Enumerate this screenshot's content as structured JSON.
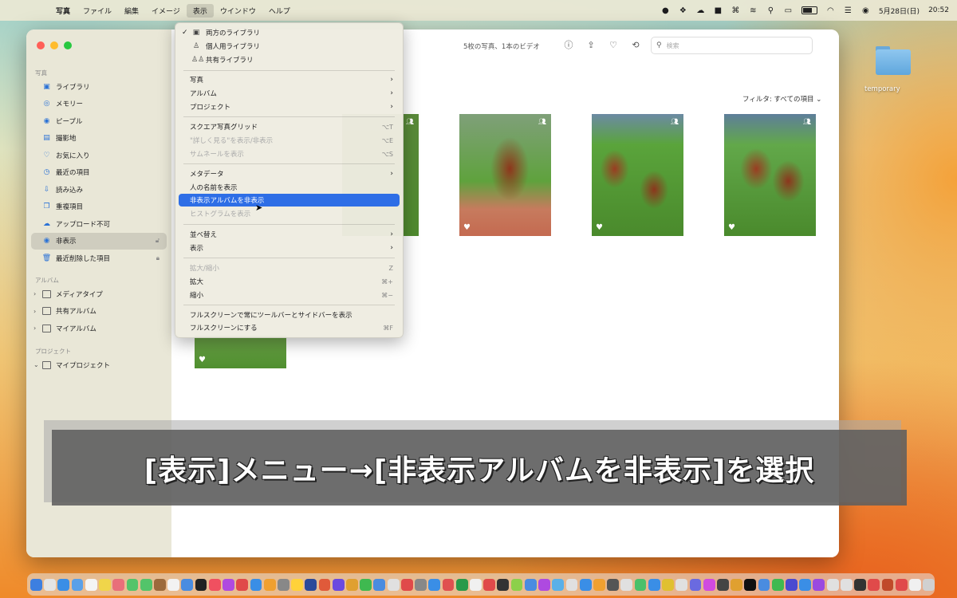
{
  "menubar": {
    "app": "写真",
    "menus": [
      "ファイル",
      "編集",
      "イメージ",
      "表示",
      "ウインドウ",
      "ヘルプ"
    ],
    "date": "5月28日(日)",
    "time": "20:52"
  },
  "sidebar": {
    "section_photos": "写真",
    "items": [
      {
        "label": "ライブラリ",
        "icon": "photo-library-icon"
      },
      {
        "label": "メモリー",
        "icon": "memories-icon"
      },
      {
        "label": "ピープル",
        "icon": "people-icon"
      },
      {
        "label": "撮影地",
        "icon": "places-icon"
      },
      {
        "label": "お気に入り",
        "icon": "heart-icon"
      },
      {
        "label": "最近の項目",
        "icon": "clock-icon"
      },
      {
        "label": "読み込み",
        "icon": "import-icon"
      },
      {
        "label": "重複項目",
        "icon": "duplicates-icon"
      },
      {
        "label": "アップロード不可",
        "icon": "cloud-alert-icon"
      },
      {
        "label": "非表示",
        "icon": "eye-icon"
      },
      {
        "label": "最近削除した項目",
        "icon": "trash-icon"
      }
    ],
    "section_albums": "アルバム",
    "albums": [
      {
        "label": "メディアタイプ"
      },
      {
        "label": "共有アルバム"
      },
      {
        "label": "マイアルバム"
      }
    ],
    "section_projects": "プロジェクト",
    "projects": [
      {
        "label": "マイプロジェクト"
      }
    ]
  },
  "toolbar": {
    "count": "5枚の写真、1本のビデオ",
    "search_placeholder": "検索"
  },
  "filter": {
    "label": "フィルタ: ",
    "value": "すべての項目"
  },
  "view_menu": {
    "items": [
      {
        "label": "両方のライブラリ",
        "checked": true
      },
      {
        "label": "個人用ライブラリ"
      },
      {
        "label": "共有ライブラリ"
      },
      {
        "label": "写真"
      },
      {
        "label": "アルバム"
      },
      {
        "label": "プロジェクト"
      },
      {
        "label": "スクエア写真グリッド",
        "shortcut": "⌥T"
      },
      {
        "label": "\"詳しく見る\"を表示/非表示",
        "shortcut": "⌥E"
      },
      {
        "label": "サムネールを表示",
        "shortcut": "⌥S"
      },
      {
        "label": "メタデータ"
      },
      {
        "label": "人の名前を表示"
      },
      {
        "label": "非表示アルバムを非表示"
      },
      {
        "label": "ヒストグラムを表示"
      },
      {
        "label": "並べ替え"
      },
      {
        "label": "表示"
      },
      {
        "label": "拡大/縮小",
        "shortcut": "Z"
      },
      {
        "label": "拡大",
        "shortcut": "⌘+"
      },
      {
        "label": "縮小",
        "shortcut": "⌘−"
      },
      {
        "label": "フルスクリーンで常にツールバーとサイドバーを表示"
      },
      {
        "label": "フルスクリーンにする",
        "shortcut": "⌘F"
      }
    ]
  },
  "desktop": {
    "folder_label": "temporary"
  },
  "caption": {
    "text": "[表示]メニュー→[非表示アルバムを非表示]を選択"
  },
  "colors": {
    "highlight": "#2e6ee6",
    "accent": "#2b72d6"
  }
}
